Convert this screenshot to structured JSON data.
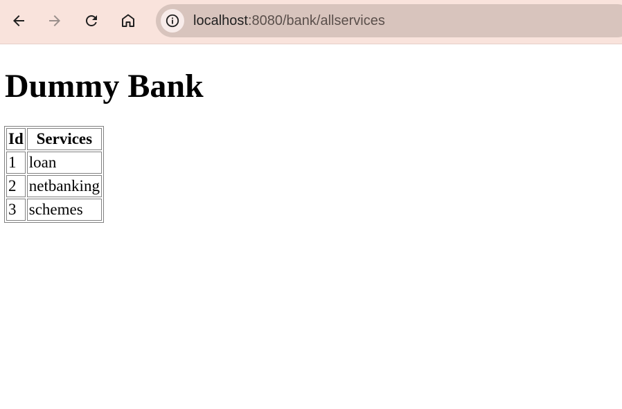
{
  "browser": {
    "url_host": "localhost",
    "url_rest": ":8080/bank/allservices",
    "icons": {
      "back": "back-arrow-icon",
      "forward": "forward-arrow-icon",
      "reload": "reload-icon",
      "home": "home-icon",
      "site_info": "info-icon"
    },
    "colors": {
      "toolbar": "#f9e3dc",
      "omnibox": "#d8c4bd"
    }
  },
  "page": {
    "title": "Dummy Bank",
    "table": {
      "headers": [
        "Id",
        "Services"
      ],
      "rows": [
        {
          "id": "1",
          "service": "loan"
        },
        {
          "id": "2",
          "service": "netbanking"
        },
        {
          "id": "3",
          "service": "schemes"
        }
      ]
    }
  }
}
